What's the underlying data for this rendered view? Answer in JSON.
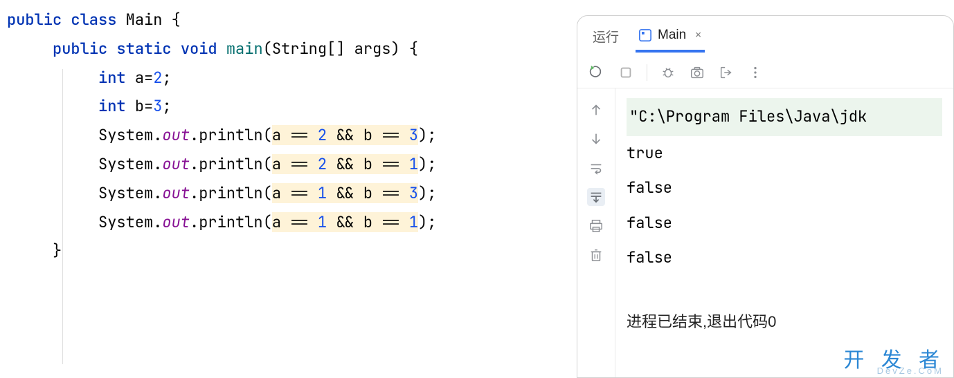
{
  "code": {
    "lines": [
      {
        "indent": 0,
        "tokens": [
          {
            "cls": "kw",
            "t": "public"
          },
          {
            "cls": "plain",
            "t": " "
          },
          {
            "cls": "kw",
            "t": "class"
          },
          {
            "cls": "plain",
            "t": " "
          },
          {
            "cls": "cls",
            "t": "Main"
          },
          {
            "cls": "plain",
            "t": " {"
          }
        ]
      },
      {
        "indent": 1,
        "tokens": [
          {
            "cls": "kw",
            "t": "public"
          },
          {
            "cls": "plain",
            "t": " "
          },
          {
            "cls": "kw",
            "t": "static"
          },
          {
            "cls": "plain",
            "t": " "
          },
          {
            "cls": "kw",
            "t": "void"
          },
          {
            "cls": "plain",
            "t": " "
          },
          {
            "cls": "method-decl",
            "t": "main"
          },
          {
            "cls": "plain",
            "t": "(String[] args) {"
          }
        ]
      },
      {
        "indent": 2,
        "tokens": [
          {
            "cls": "type",
            "t": "int"
          },
          {
            "cls": "plain",
            "t": " a="
          },
          {
            "cls": "num",
            "t": "2"
          },
          {
            "cls": "plain",
            "t": ";"
          }
        ]
      },
      {
        "indent": 2,
        "tokens": [
          {
            "cls": "type",
            "t": "int"
          },
          {
            "cls": "plain",
            "t": " b="
          },
          {
            "cls": "num",
            "t": "3"
          },
          {
            "cls": "plain",
            "t": ";"
          }
        ]
      },
      {
        "indent": 2,
        "tokens": [
          {
            "cls": "plain",
            "t": "System."
          },
          {
            "cls": "field",
            "t": "out"
          },
          {
            "cls": "plain",
            "t": ".println("
          },
          {
            "cls": "plain hl",
            "t": "a == "
          },
          {
            "cls": "num hl",
            "t": "2"
          },
          {
            "cls": "plain hl",
            "t": " && b == "
          },
          {
            "cls": "num hl",
            "t": "3"
          },
          {
            "cls": "plain",
            "t": ");"
          }
        ]
      },
      {
        "indent": 2,
        "tokens": [
          {
            "cls": "plain",
            "t": "System."
          },
          {
            "cls": "field",
            "t": "out"
          },
          {
            "cls": "plain",
            "t": ".println("
          },
          {
            "cls": "plain hl",
            "t": "a == "
          },
          {
            "cls": "num hl",
            "t": "2"
          },
          {
            "cls": "plain hl",
            "t": " && b == "
          },
          {
            "cls": "num hl",
            "t": "1"
          },
          {
            "cls": "plain",
            "t": ");"
          }
        ]
      },
      {
        "indent": 2,
        "tokens": [
          {
            "cls": "plain",
            "t": "System."
          },
          {
            "cls": "field",
            "t": "out"
          },
          {
            "cls": "plain",
            "t": ".println("
          },
          {
            "cls": "plain hl",
            "t": "a == "
          },
          {
            "cls": "num hl",
            "t": "1"
          },
          {
            "cls": "plain hl",
            "t": " && b == "
          },
          {
            "cls": "num hl",
            "t": "3"
          },
          {
            "cls": "plain",
            "t": ");"
          }
        ]
      },
      {
        "indent": 2,
        "tokens": [
          {
            "cls": "plain",
            "t": "System."
          },
          {
            "cls": "field",
            "t": "out"
          },
          {
            "cls": "plain",
            "t": ".println("
          },
          {
            "cls": "plain hl",
            "t": "a == "
          },
          {
            "cls": "num hl",
            "t": "1"
          },
          {
            "cls": "plain hl",
            "t": " && b == "
          },
          {
            "cls": "num hl",
            "t": "1"
          },
          {
            "cls": "plain",
            "t": ");"
          }
        ]
      },
      {
        "indent": 0,
        "tokens": [
          {
            "cls": "plain",
            "t": ""
          }
        ]
      },
      {
        "indent": 1,
        "tokens": [
          {
            "cls": "plain",
            "t": "}"
          }
        ]
      }
    ]
  },
  "panel": {
    "run_tab": "运行",
    "active_tab": "Main",
    "close_char": "×"
  },
  "toolbar": {
    "icons": [
      "rerun-icon",
      "stop-icon",
      "debug-icon",
      "camera-icon",
      "exit-icon",
      "more-icon"
    ]
  },
  "gutter": {
    "icons": [
      "up-arrow-icon",
      "down-arrow-icon",
      "soft-wrap-icon",
      "scroll-end-icon",
      "print-icon",
      "trash-icon"
    ]
  },
  "console": {
    "cmd": "\"C:\\Program Files\\Java\\jdk",
    "lines": [
      "true",
      "false",
      "false",
      "false"
    ],
    "exit_msg": "进程已结束,退出代码0"
  },
  "watermark": "开 发 者",
  "watermark_sub": "DevZe.CoM"
}
